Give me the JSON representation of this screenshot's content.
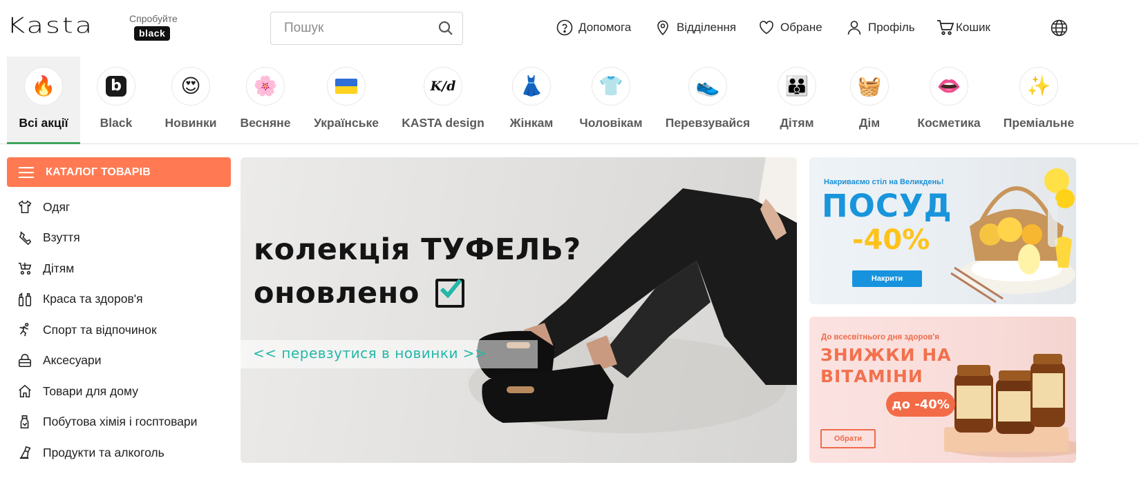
{
  "header": {
    "logo_text": "Kasta",
    "try_text": "Спробуйте",
    "black_badge": "black",
    "search_placeholder": "Пошук",
    "nav": {
      "help": "Допомога",
      "branches": "Відділення",
      "favorites": "Обране",
      "profile": "Профіль",
      "cart": "Кошик"
    }
  },
  "categories": [
    {
      "label": "Всі акції",
      "icon": "fire-icon",
      "glyph": "🔥",
      "active": true
    },
    {
      "label": "Black",
      "icon": "black-b-icon",
      "glyph": "b"
    },
    {
      "label": "Новинки",
      "icon": "heart-eyes-icon",
      "glyph": "😍"
    },
    {
      "label": "Весняне",
      "icon": "flower-icon",
      "glyph": "🌸"
    },
    {
      "label": "Українське",
      "icon": "ukraine-flag-icon",
      "glyph": ""
    },
    {
      "label": "KASTA design",
      "icon": "kd-logo-icon",
      "glyph": "K/d"
    },
    {
      "label": "Жінкам",
      "icon": "dress-icon",
      "glyph": "👗"
    },
    {
      "label": "Чоловікам",
      "icon": "shirt-icon",
      "glyph": "👕"
    },
    {
      "label": "Перевзувайся",
      "icon": "sneaker-icon",
      "glyph": "👟"
    },
    {
      "label": "Дітям",
      "icon": "family-icon",
      "glyph": "👪"
    },
    {
      "label": "Дім",
      "icon": "basket-icon",
      "glyph": "🧺"
    },
    {
      "label": "Косметика",
      "icon": "lips-icon",
      "glyph": "👄"
    },
    {
      "label": "Преміальне",
      "icon": "sparkles-icon",
      "glyph": "✨"
    }
  ],
  "catalog": {
    "button_label": "КАТАЛОГ ТОВАРІВ",
    "items": [
      {
        "label": "Одяг",
        "icon": "tshirt-icon"
      },
      {
        "label": "Взуття",
        "icon": "shoe-icon"
      },
      {
        "label": "Дітям",
        "icon": "stroller-icon"
      },
      {
        "label": "Краса та здоров'я",
        "icon": "cosmetics-icon"
      },
      {
        "label": "Спорт та відпочинок",
        "icon": "running-icon"
      },
      {
        "label": "Аксесуари",
        "icon": "bag-icon"
      },
      {
        "label": "Товари для дому",
        "icon": "house-icon"
      },
      {
        "label": "Побутова хімія і госптовари",
        "icon": "spray-icon"
      },
      {
        "label": "Продукти та алкоголь",
        "icon": "food-icon"
      }
    ]
  },
  "hero": {
    "line1": "колекція ТУФЕЛЬ?",
    "line2": "оновлено",
    "cta": "<< перевзутися в новинки >>"
  },
  "promo1": {
    "subtitle": "Накриваємо стіл на Великдень!",
    "title": "ПОСУД",
    "discount": "-40%",
    "button": "Накрити"
  },
  "promo2": {
    "subtitle": "До всесвітнього дня здоров'я",
    "title_line1": "ЗНИЖКИ НА",
    "title_line2": "ВІТАМІНИ",
    "discount": "до -40%",
    "button": "Обрати"
  },
  "colors": {
    "accent_orange": "#ff7a52",
    "active_underline": "#3fa55b",
    "promo_blue": "#1995dc",
    "promo_yellow": "#ffc21a",
    "promo_coral": "#f2714e",
    "cta_teal": "#22b8a8"
  }
}
